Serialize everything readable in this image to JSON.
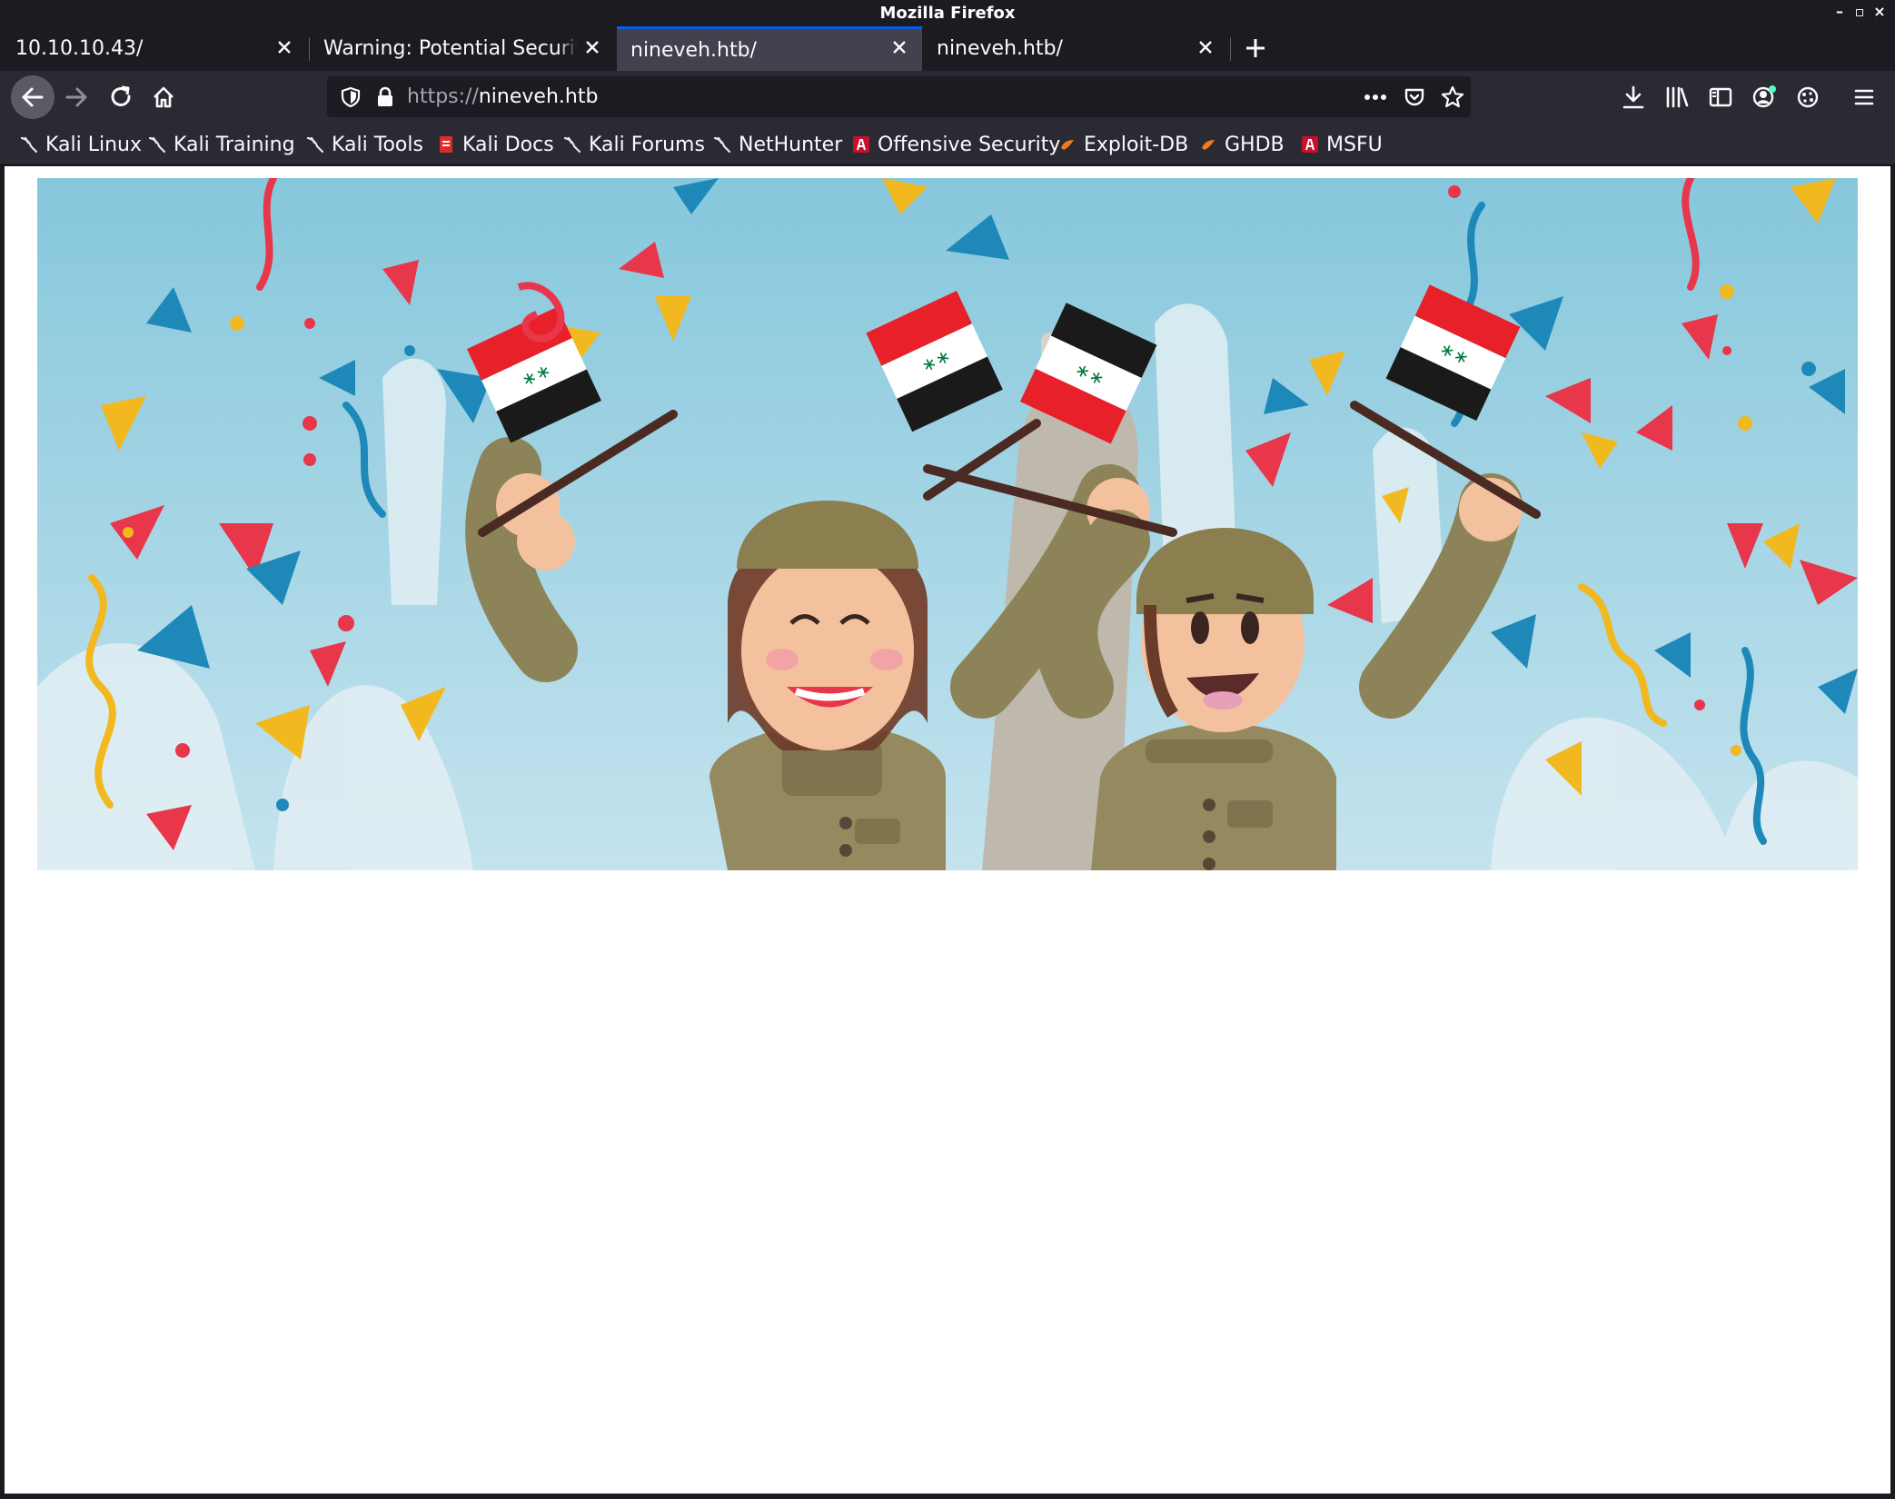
{
  "window": {
    "title": "Mozilla Firefox",
    "controls": {
      "minimize": "–",
      "maximize": "▫",
      "close": "×"
    }
  },
  "tabs": [
    {
      "label": "10.10.10.43/",
      "selected": false
    },
    {
      "label": "Warning: Potential Security Risk Ahead",
      "selected": false
    },
    {
      "label": "nineveh.htb/",
      "selected": true
    },
    {
      "label": "nineveh.htb/",
      "selected": false
    }
  ],
  "navbar": {
    "url_protocol": "https://",
    "url_host": "nineveh.htb",
    "icons": [
      "back-icon",
      "forward-icon",
      "reload-icon",
      "home-icon",
      "shield-icon",
      "lock-icon",
      "more-icon",
      "pocket-icon",
      "star-icon",
      "download-icon",
      "library-icon",
      "sidebar-icon",
      "account-icon",
      "extensions-icon",
      "menu-icon"
    ]
  },
  "bookmarks": [
    {
      "label": "Kali Linux",
      "icon": "kali-dragon-icon"
    },
    {
      "label": "Kali Training",
      "icon": "kali-dragon-icon"
    },
    {
      "label": "Kali Tools",
      "icon": "kali-dragon-icon"
    },
    {
      "label": "Kali Docs",
      "icon": "kali-docs-icon"
    },
    {
      "label": "Kali Forums",
      "icon": "kali-dragon-icon"
    },
    {
      "label": "NetHunter",
      "icon": "kali-dragon-icon"
    },
    {
      "label": "Offensive Security",
      "icon": "offsec-icon"
    },
    {
      "label": "Exploit-DB",
      "icon": "exploitdb-icon"
    },
    {
      "label": "GHDB",
      "icon": "exploitdb-icon"
    },
    {
      "label": "MSFU",
      "icon": "offsec-icon"
    }
  ],
  "colors": {
    "chrome_dark": "#1c1b22",
    "toolbar": "#2b2a33",
    "selected_tab": "#42414d",
    "accent": "#0060df",
    "banner_sky": "#8fcbe0"
  }
}
